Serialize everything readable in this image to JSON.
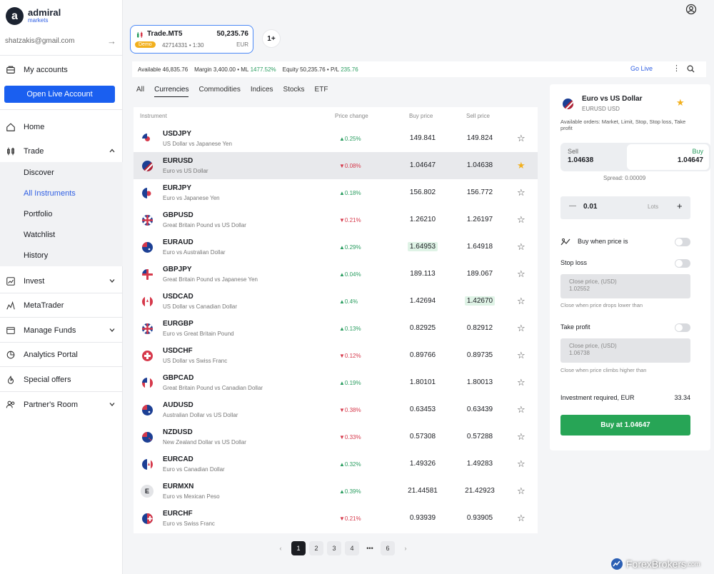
{
  "brand": {
    "name": "admiral",
    "sub": "markets"
  },
  "user": {
    "email": "shatzakis@gmail.com"
  },
  "sidebar": {
    "my_accounts": "My accounts",
    "open_live": "Open Live Account",
    "home": "Home",
    "trade": "Trade",
    "trade_sub": [
      "Discover",
      "All Instruments",
      "Portfolio",
      "Watchlist",
      "History"
    ],
    "invest": "Invest",
    "metatrader": "MetaTrader",
    "manage_funds": "Manage Funds",
    "analytics": "Analytics Portal",
    "special": "Special offers",
    "partner": "Partner's Room"
  },
  "account": {
    "name": "Trade.MT5",
    "balance": "50,235.76",
    "badge": "Demo",
    "number": "42714331 • 1:30",
    "currency": "EUR",
    "add_label": "1+"
  },
  "status": {
    "available_label": "Available",
    "available": "46,835.76",
    "margin_label": "Margin",
    "margin": "3,400.00",
    "ml_label": "• ML",
    "ml": "1477.52%",
    "equity_label": "Equity",
    "equity": "50,235.76",
    "pl_label": "• P/L",
    "pl": "235.76",
    "go_live": "Go Live"
  },
  "tabs": [
    "All",
    "Currencies",
    "Commodities",
    "Indices",
    "Stocks",
    "ETF"
  ],
  "table": {
    "headers": {
      "instrument": "Instrument",
      "change": "Price change",
      "buy": "Buy price",
      "sell": "Sell price"
    },
    "rows": [
      {
        "sym": "USDJPY",
        "desc": "US Dollar vs Japanese Yen",
        "chg": "▲0.25%",
        "buy": "149.841",
        "sell": "149.824"
      },
      {
        "sym": "EURUSD",
        "desc": "Euro vs US Dollar",
        "chg": "▼0.08%",
        "buy": "1.04647",
        "sell": "1.04638"
      },
      {
        "sym": "EURJPY",
        "desc": "Euro vs Japanese Yen",
        "chg": "▲0.18%",
        "buy": "156.802",
        "sell": "156.772"
      },
      {
        "sym": "GBPUSD",
        "desc": "Great Britain Pound vs US Dollar",
        "chg": "▼0.21%",
        "buy": "1.26210",
        "sell": "1.26197"
      },
      {
        "sym": "EURAUD",
        "desc": "Euro vs Australian Dollar",
        "chg": "▲0.29%",
        "buy": "1.64953",
        "sell": "1.64918"
      },
      {
        "sym": "GBPJPY",
        "desc": "Great Britain Pound vs Japanese Yen",
        "chg": "▲0.04%",
        "buy": "189.113",
        "sell": "189.067"
      },
      {
        "sym": "USDCAD",
        "desc": "US Dollar vs Canadian Dollar",
        "chg": "▲0.4%",
        "buy": "1.42694",
        "sell": "1.42670"
      },
      {
        "sym": "EURGBP",
        "desc": "Euro vs Great Britain Pound",
        "chg": "▲0.13%",
        "buy": "0.82925",
        "sell": "0.82912"
      },
      {
        "sym": "USDCHF",
        "desc": "US Dollar vs Swiss Franc",
        "chg": "▼0.12%",
        "buy": "0.89766",
        "sell": "0.89735"
      },
      {
        "sym": "GBPCAD",
        "desc": "Great Britain Pound vs Canadian Dollar",
        "chg": "▲0.19%",
        "buy": "1.80101",
        "sell": "1.80013"
      },
      {
        "sym": "AUDUSD",
        "desc": "Australian Dollar vs US Dollar",
        "chg": "▼0.38%",
        "buy": "0.63453",
        "sell": "0.63439"
      },
      {
        "sym": "NZDUSD",
        "desc": "New Zealand Dollar vs US Dollar",
        "chg": "▼0.33%",
        "buy": "0.57308",
        "sell": "0.57288"
      },
      {
        "sym": "EURCAD",
        "desc": "Euro vs Canadian Dollar",
        "chg": "▲0.32%",
        "buy": "1.49326",
        "sell": "1.49283"
      },
      {
        "sym": "EURMXN",
        "desc": "Euro vs Mexican Peso",
        "chg": "▲0.39%",
        "buy": "21.44581",
        "sell": "21.42923"
      },
      {
        "sym": "EURCHF",
        "desc": "Euro vs Swiss Franc",
        "chg": "▼0.21%",
        "buy": "0.93939",
        "sell": "0.93905"
      }
    ]
  },
  "pagination": {
    "pages": [
      "1",
      "2",
      "3",
      "4",
      "•••",
      "6"
    ],
    "prev": "‹",
    "next": "›"
  },
  "panel": {
    "title": "Euro vs US Dollar",
    "subtitle": "EURUSD USD",
    "orders": "Available orders: Market, Limit, Stop, Stop loss, Take profit",
    "sell_label": "Sell",
    "sell_price": "1.04638",
    "buy_label": "Buy",
    "buy_price": "1.04647",
    "spread": "Spread: 0.00009",
    "lots_value": "0.01",
    "lots_label": "Lots",
    "buy_when": "Buy when price is",
    "stop_loss": "Stop loss",
    "sl_placeholder": "Close price, (USD)",
    "sl_value": "1.02552",
    "sl_hint": "Close when price drops lower than",
    "take_profit": "Take profit",
    "tp_placeholder": "Close price, (USD)",
    "tp_value": "1.06738",
    "tp_hint": "Close when price climbs higher than",
    "investment_label": "Investment required, EUR",
    "investment": "33.34",
    "buy_button": "Buy at 1.04647"
  },
  "watermark": {
    "brand": "ForexBrokers",
    "tld": ".com"
  }
}
